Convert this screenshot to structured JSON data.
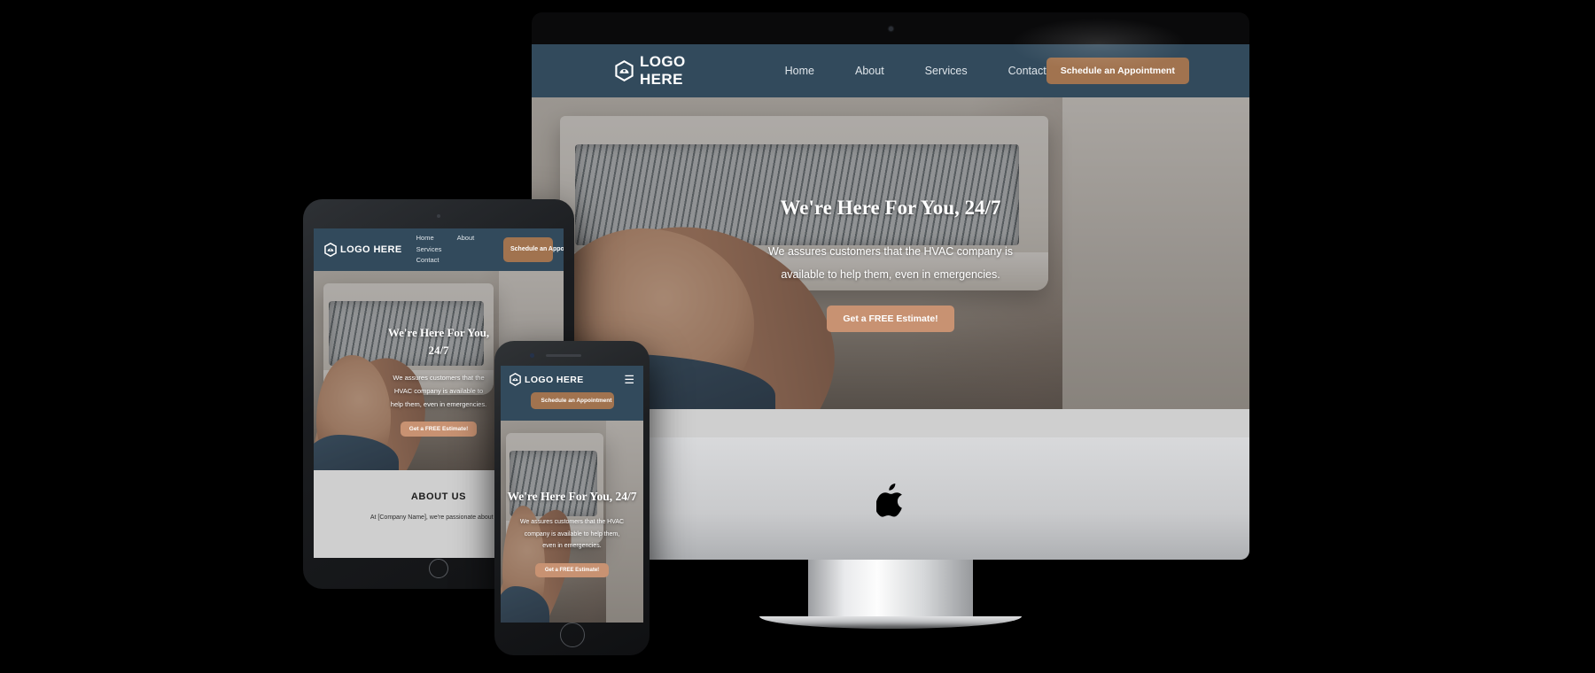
{
  "site": {
    "brand": {
      "name": "LOGO HERE",
      "logo_icon": "hexagon-logo-icon"
    },
    "nav": {
      "links": [
        "Home",
        "About",
        "Services",
        "Contact"
      ],
      "cta_label": "Schedule an Appointment",
      "mobile_menu_icon": "hamburger-menu-icon"
    },
    "hero": {
      "title": "We're Here For You, 24/7",
      "subtitle": "We assures customers that the HVAC company is available to help them, even in emergencies.",
      "button_label": "Get a FREE Estimate!",
      "image_alt": "hvac-technician-servicing-wall-mounted-air-conditioner"
    },
    "about": {
      "title": "ABOUT US",
      "body": "At [Company Name], we're passionate about prov"
    },
    "colors": {
      "nav_background": "#324a5c",
      "nav_cta": "#a1734f",
      "hero_button": "#c89272",
      "about_background": "#cfcfcf",
      "page_background": "#000000",
      "text_light": "#ffffff"
    }
  },
  "devices": {
    "desktop": {
      "name": "imac-desktop-mockup",
      "logo_icon": "apple-logo-icon",
      "camera_icon": "webcam-dot-icon"
    },
    "tablet": {
      "name": "ipad-tablet-mockup",
      "home_button_icon": "home-button-icon",
      "camera_icon": "front-camera-dot-icon"
    },
    "phone": {
      "name": "iphone-mobile-mockup",
      "home_button_icon": "home-button-icon",
      "camera_icon": "front-camera-dot-icon",
      "speaker_icon": "earpiece-speaker-icon"
    }
  }
}
